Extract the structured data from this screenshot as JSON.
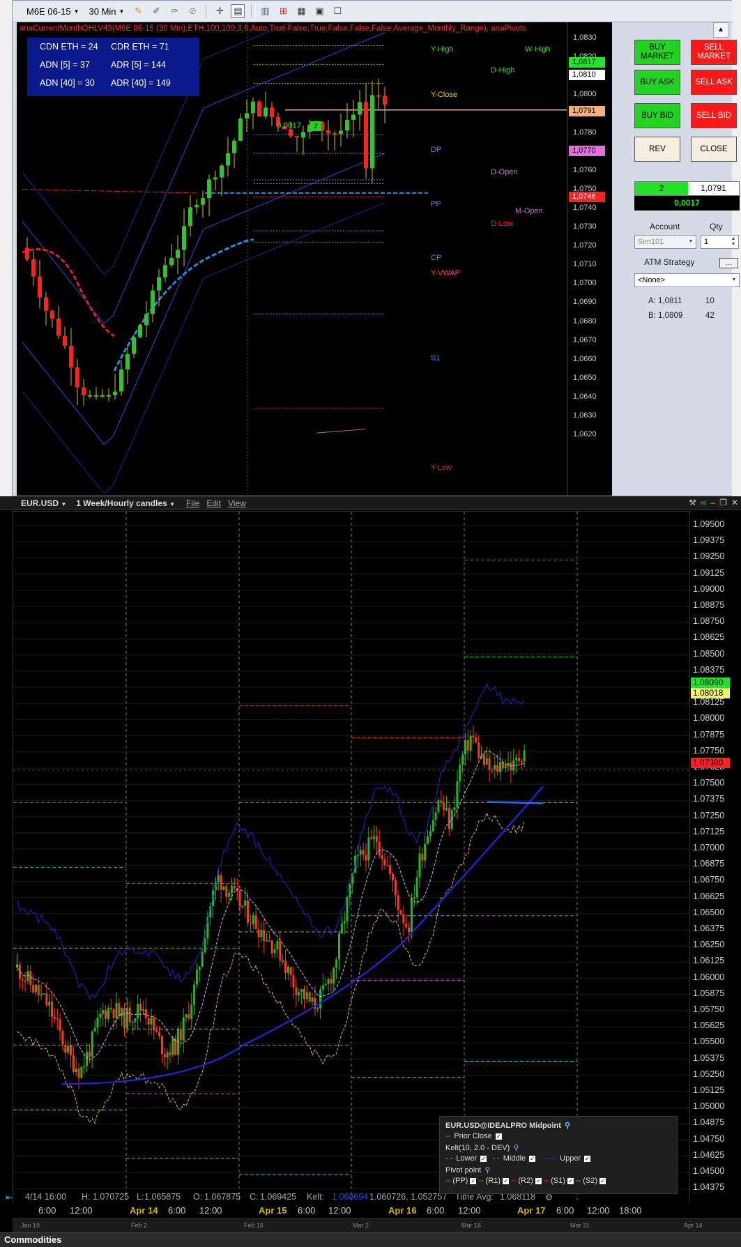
{
  "nt": {
    "toolbar": {
      "instrument": "M6E 06-15",
      "period": "30 Min"
    },
    "indicator_title": "anaCurrentMonthOHLV43(M6E 06-15 (30 Min),ETH,100,100,3,6,Auto,True,False,True,False,False,False,Average_Monthly_Range), anaPivots",
    "infobox": {
      "cdn_eth": "CDN ETH = 24",
      "cdr_eth": "CDR ETH = 71",
      "adn5": "ADN [5] = 37",
      "adr5": "ADR [5] = 144",
      "adn40": "ADN [40] = 30",
      "adr40": "ADR [40] = 149"
    },
    "pivot_labels": {
      "y_high": "Y-High",
      "w_high": "W-High",
      "d_high": "D-High",
      "y_close": "Y-Close",
      "dp": "DP",
      "d_open": "D-Open",
      "pp": "PP",
      "m_open": "M-Open",
      "d_low": "D-Low",
      "cp": "CP",
      "y_vwap": "Y-VWAP",
      "s1": "S1",
      "y_low": "Y-Low"
    },
    "position_label": "0,0017",
    "position_qty_box": "2",
    "price_axis": [
      "1,0830",
      "1,0820",
      "1,0810",
      "1,0800",
      "1,0790",
      "1,0780",
      "1,0770",
      "1,0760",
      "1,0750",
      "1,0740",
      "1,0730",
      "1,0720",
      "1,0710",
      "1,0700",
      "1,0690",
      "1,0680",
      "1,0670",
      "1,0660",
      "1,0650",
      "1,0640",
      "1,0630",
      "1,0620"
    ],
    "price_tags": {
      "ask": "1,0817",
      "last": "1,0810",
      "position": "1,0791",
      "d_open": "1,0770",
      "d_low": "1,0746"
    },
    "colors": {
      "buy": "#22d322",
      "sell": "#ff1818",
      "up_candle": "#2ec42e",
      "down_candle": "#ff2020"
    },
    "order": {
      "buy_market": "BUY MARKET",
      "sell_market": "SELL MARKET",
      "buy_ask": "BUY ASK",
      "sell_ask": "SELL ASK",
      "buy_bid": "BUY BID",
      "sell_bid": "SELL BID",
      "rev": "REV",
      "close": "CLOSE",
      "position_qty": "2",
      "position_avg": "1,0791",
      "pnl": "0,0017",
      "account_label": "Account",
      "qty_label": "Qty",
      "account_value": "Sim101",
      "qty_value": "1",
      "atm_label": "ATM Strategy",
      "atm_value": "<None>",
      "ask_line": "A: 1,0811",
      "ask_size": "10",
      "bid_line": "B: 1,0809",
      "bid_size": "42"
    }
  },
  "tws": {
    "symbol": "EUR.USD",
    "period": "1 Week/Hourly candles",
    "menu": {
      "file": "File",
      "edit": "Edit",
      "view": "View"
    },
    "price_axis": [
      "1.09500",
      "1.09375",
      "1.09250",
      "1.09125",
      "1.09000",
      "1.08875",
      "1.08750",
      "1.08625",
      "1.08500",
      "1.08375",
      "1.08250",
      "1.08125",
      "1.08000",
      "1.07875",
      "1.07750",
      "1.07625",
      "1.07500",
      "1.07375",
      "1.07250",
      "1.07125",
      "1.07000",
      "1.06875",
      "1.06750",
      "1.06625",
      "1.06500",
      "1.06375",
      "1.06250",
      "1.06125",
      "1.06000",
      "1.05875",
      "1.05750",
      "1.05625",
      "1.05500",
      "1.05375",
      "1.05250",
      "1.05125",
      "1.05000",
      "1.04875",
      "1.04750",
      "1.04625",
      "1.04500",
      "1.04375"
    ],
    "price_tags": {
      "upper": "1.08090",
      "last": "1.08018",
      "prior_close": "1.07380"
    },
    "status": {
      "date": "4/14 16:00",
      "h_label": "H:",
      "h": "1.070725",
      "l_label": "L:",
      "l": "1.065875",
      "o_label": "O:",
      "o": "1.067875",
      "c_label": "C:",
      "c": "1.069425",
      "kelt_label": "Kelt:",
      "kelt_upper": "1.068694",
      "kelt": "1.060726, 1.052757",
      "time_avg_label": "Time Avg:",
      "time_avg": "1.068118"
    },
    "time_axis": [
      {
        "t": "6:00",
        "day": false
      },
      {
        "t": "12:00",
        "day": false
      },
      {
        "t": "Apr 14",
        "day": true
      },
      {
        "t": "6:00",
        "day": false
      },
      {
        "t": "12:00",
        "day": false
      },
      {
        "t": "Apr 15",
        "day": true
      },
      {
        "t": "6:00",
        "day": false
      },
      {
        "t": "12:00",
        "day": false
      },
      {
        "t": "Apr 16",
        "day": true
      },
      {
        "t": "6:00",
        "day": false
      },
      {
        "t": "12:00",
        "day": false
      },
      {
        "t": "Apr 17",
        "day": true
      },
      {
        "t": "6:00",
        "day": false
      },
      {
        "t": "12:00",
        "day": false
      },
      {
        "t": "18:00",
        "day": false
      }
    ],
    "navigator": [
      "Jan 19",
      "Feb 2",
      "Feb 16",
      "Mar 2",
      "Mar 16",
      "Mar 31",
      "Apr 14"
    ],
    "legend": {
      "title": "EUR.USD@IDEALPRO Midpoint",
      "prior_close": "Prior Close",
      "kelt": "Kelt(10, 2.0 - DEV)",
      "lower": "Lower",
      "middle": "Middle",
      "upper": "Upper",
      "pivot": "Pivot point",
      "pp": "(PP)",
      "r1": "(R1)",
      "r2": "(R2)",
      "s1": "(S1)",
      "s2": "(S2)"
    },
    "footer": "Commodities"
  }
}
